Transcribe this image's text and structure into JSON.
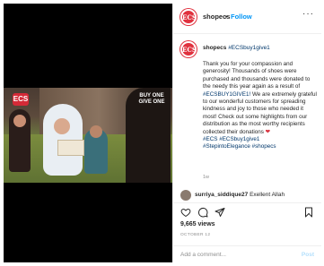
{
  "header": {
    "avatar_text": "ECS",
    "username": "shopecs",
    "separator": "•",
    "follow_label": "Follow",
    "more_label": "···"
  },
  "media": {
    "logo_text": "ECS",
    "overlay_text": "BUY ONE GIVE ONE"
  },
  "caption": {
    "username": "shopecs",
    "hashtag": "#ECSbuy1give1",
    "body_start": "Thank you for your compassion and generosity! Thousands of shoes were purchased and thousands were donated to the needy this year again as a result of ",
    "body_tag": "#ECSBUY1GIVE1!",
    "body_end": " We are extremely grateful to our wonderful customers for spreading kindness and joy to those who needed it most! Check out some highlights from our distribution as the most worthy recipients collected their donations",
    "emoji": "❤",
    "tags_line1": "#ECS #ECSbuy1give1",
    "tags_line2": "#StepintoElegance #shopecs",
    "time": "1w"
  },
  "comment": {
    "username": "surriya_siddique27",
    "text": "Exellent Allah"
  },
  "actions": {
    "views": "9,665 views",
    "date": "OCTOBER 12"
  },
  "add_comment": {
    "placeholder": "Add a comment...",
    "post_label": "Post"
  }
}
